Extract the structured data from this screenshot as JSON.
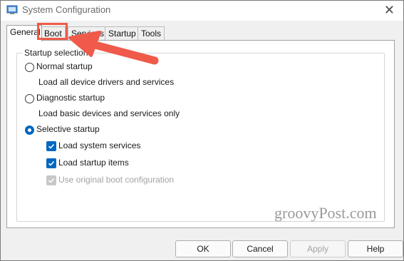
{
  "window": {
    "title": "System Configuration",
    "close_glyph": "✕",
    "icon": "msconfig-icon"
  },
  "tabs": [
    {
      "label": "General",
      "active": true
    },
    {
      "label": "Boot",
      "active": false
    },
    {
      "label": "Services",
      "active": false
    },
    {
      "label": "Startup",
      "active": false
    },
    {
      "label": "Tools",
      "active": false
    }
  ],
  "startup": {
    "group_label": "Startup selection",
    "normal": {
      "label": "Normal startup",
      "desc": "Load all device drivers and services",
      "selected": false
    },
    "diagnostic": {
      "label": "Diagnostic startup",
      "desc": "Load basic devices and services only",
      "selected": false
    },
    "selective": {
      "label": "Selective startup",
      "selected": true
    },
    "options": [
      {
        "label": "Load system services",
        "checked": true,
        "enabled": true
      },
      {
        "label": "Load startup items",
        "checked": true,
        "enabled": true
      },
      {
        "label": "Use original boot configuration",
        "checked": true,
        "enabled": false
      }
    ]
  },
  "watermark": "groovyPost.com",
  "buttons": {
    "ok": "OK",
    "cancel": "Cancel",
    "apply": "Apply",
    "help": "Help"
  },
  "colors": {
    "accent": "#0067c0",
    "annotation": "#ef5a4a"
  }
}
